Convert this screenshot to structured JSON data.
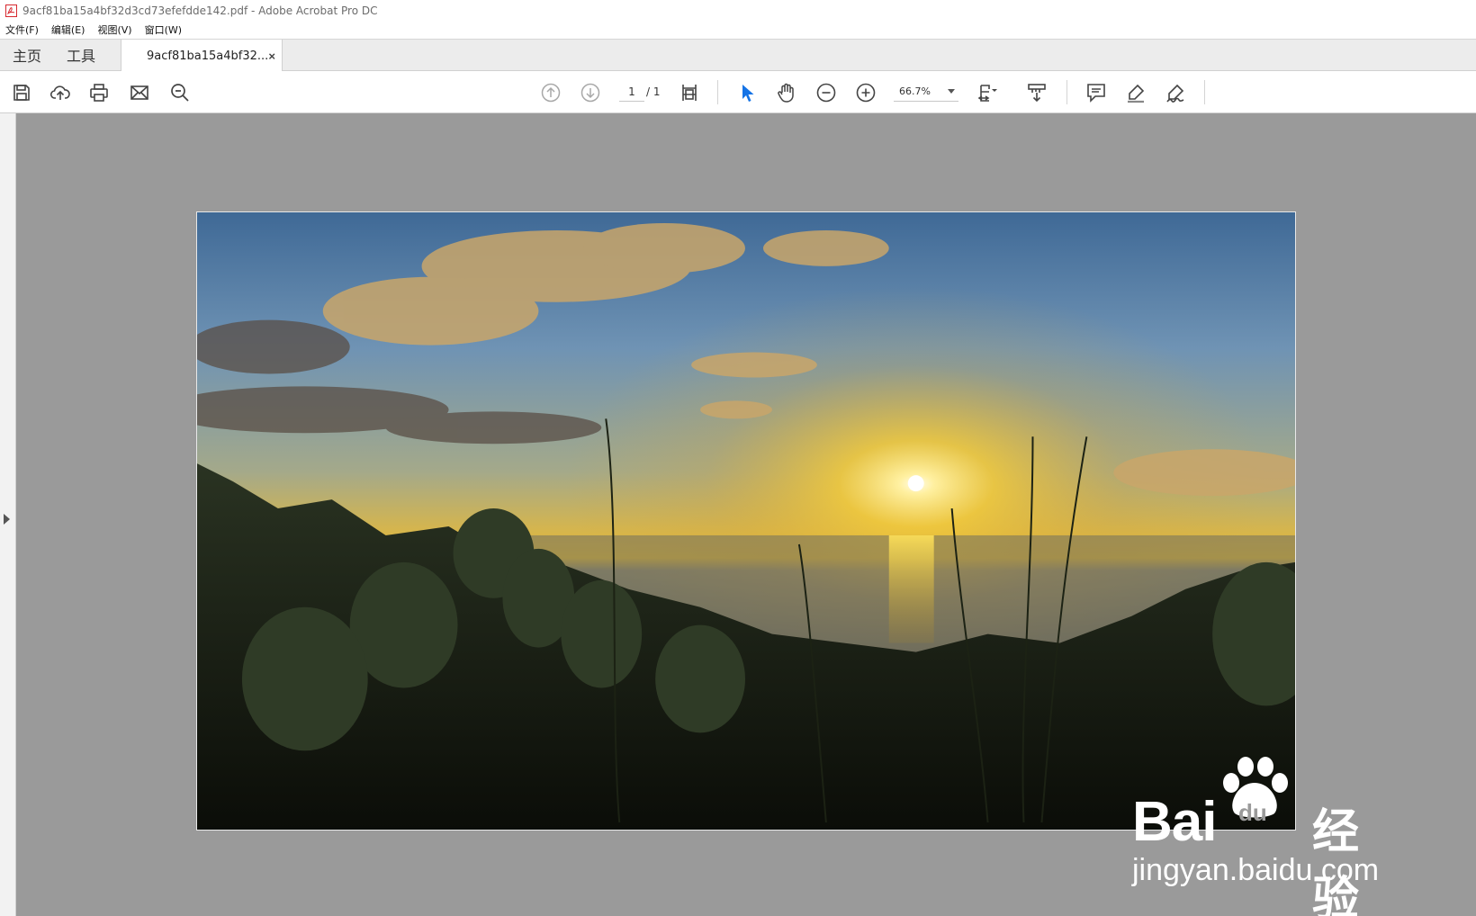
{
  "window": {
    "title": "9acf81ba15a4bf32d3cd73efefdde142.pdf - Adobe Acrobat Pro DC"
  },
  "menu": {
    "items": [
      "文件(F)",
      "编辑(E)",
      "视图(V)",
      "窗口(W)"
    ]
  },
  "tabs": {
    "home": "主页",
    "tools": "工具",
    "document": "9acf81ba15a4bf32...",
    "close": "×"
  },
  "toolbar": {
    "current_page": "1",
    "total_pages": "/ 1",
    "zoom": "66.7%"
  },
  "icons": {
    "save": "save-icon",
    "upload": "cloud-upload-icon",
    "print": "print-icon",
    "email": "mail-icon",
    "search": "search-icon",
    "prev_page": "arrow-up-circle-icon",
    "next_page": "arrow-down-circle-icon",
    "page_layout": "page-fit-icon",
    "select": "cursor-arrow-icon",
    "hand": "hand-icon",
    "zoom_out": "zoom-out-icon",
    "zoom_in": "zoom-in-icon",
    "fit_page": "fit-page-icon",
    "scroll_mode": "scroll-mode-icon",
    "comment": "comment-icon",
    "highlight": "highlighter-icon",
    "sign": "sign-icon"
  },
  "watermark": {
    "brand": "Bai",
    "paw_text": "du",
    "cn": "经验",
    "url": "jingyan.baidu.com"
  },
  "colors": {
    "accent_cursor": "#1473e6",
    "pdf_red": "#d7282f",
    "canvas_gray": "#9a9a9a"
  }
}
